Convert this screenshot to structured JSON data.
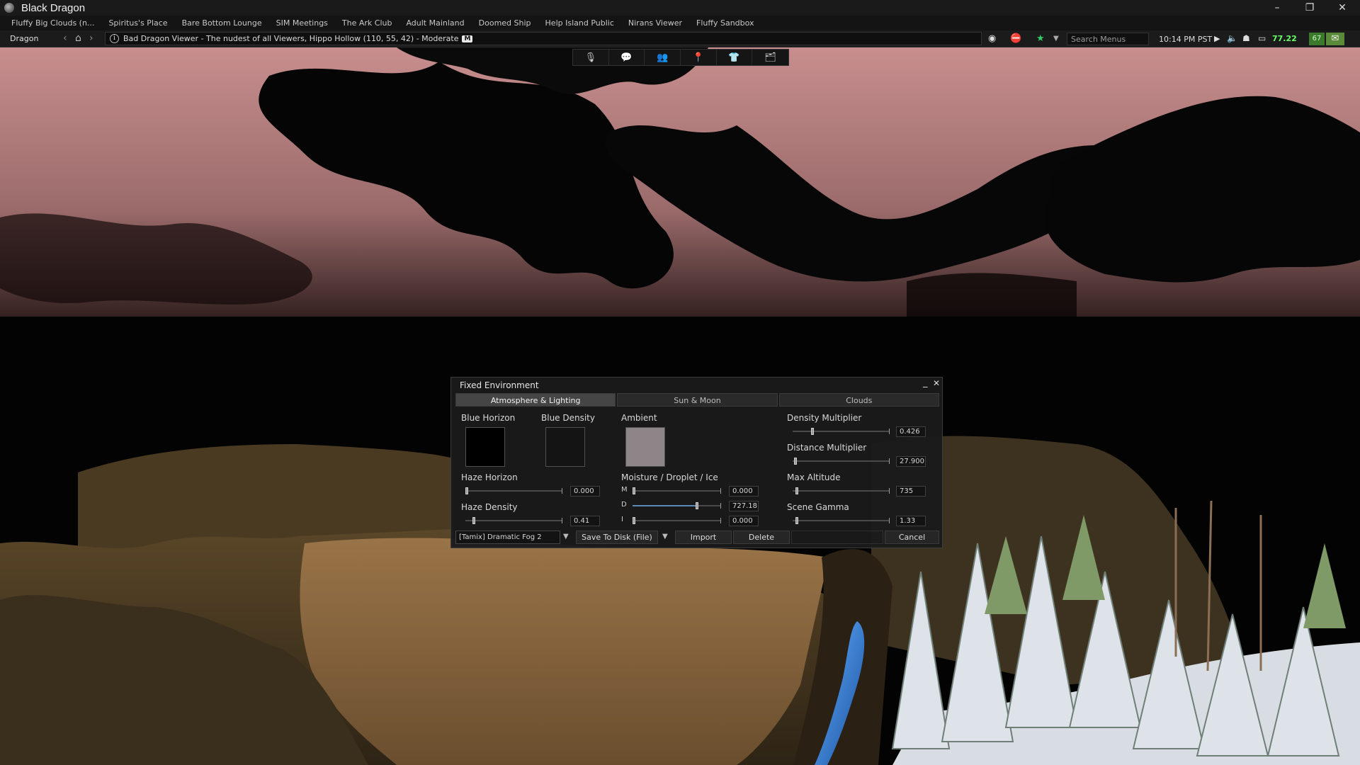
{
  "window": {
    "title": "Black Dragon",
    "minimize": "–",
    "restore": "❐",
    "close": "✕"
  },
  "favorites": [
    "Fluffy Big Clouds (n...",
    "Spiritus's Place",
    "Bare Bottom Lounge",
    "SIM Meetings",
    "The Ark Club",
    "Adult Mainland",
    "Doomed Ship",
    "Help Island Public",
    "Nirans Viewer",
    "Fluffy Sandbox"
  ],
  "navbar": {
    "home_label": "Dragon",
    "location_text": "Bad Dragon Viewer - The nudest of all Viewers, Hippo Hollow (110, 55, 42) - Moderate",
    "maturity_badge": "M",
    "search_placeholder": "Search Menus",
    "clock": "10:14 PM PST",
    "fps": "77.22",
    "fps_box": "67"
  },
  "toolbar": {
    "icons": [
      "microphone-icon",
      "chat-icon",
      "people-icon",
      "places-icon",
      "appearance-icon",
      "inventory-icon"
    ]
  },
  "floater": {
    "title": "Fixed Environment",
    "tabs": [
      {
        "label": "Atmosphere & Lighting",
        "active": true
      },
      {
        "label": "Sun & Moon",
        "active": false
      },
      {
        "label": "Clouds",
        "active": false
      }
    ],
    "blue_horizon": {
      "label": "Blue Horizon",
      "color": "#000000"
    },
    "blue_density": {
      "label": "Blue Density",
      "color": "#141414"
    },
    "ambient": {
      "label": "Ambient",
      "color": "#8e8589"
    },
    "haze_horizon": {
      "label": "Haze Horizon",
      "value": "0.000"
    },
    "haze_density": {
      "label": "Haze Density",
      "value": "0.41"
    },
    "moisture": {
      "label": "Moisture / Droplet / Ice",
      "m_label": "M",
      "m_value": "0.000",
      "d_label": "D",
      "d_value": "727.18",
      "i_label": "I",
      "i_value": "0.000"
    },
    "density_multiplier": {
      "label": "Density Multiplier",
      "value": "0.426"
    },
    "distance_multiplier": {
      "label": "Distance Multiplier",
      "value": "27.900"
    },
    "max_altitude": {
      "label": "Max Altitude",
      "value": "735"
    },
    "scene_gamma": {
      "label": "Scene Gamma",
      "value": "1.33"
    },
    "preset": "[Tamix] Dramatic Fog 2",
    "buttons": {
      "save": "Save To Disk (File)",
      "import": "Import",
      "delete": "Delete",
      "cancel": "Cancel"
    }
  }
}
